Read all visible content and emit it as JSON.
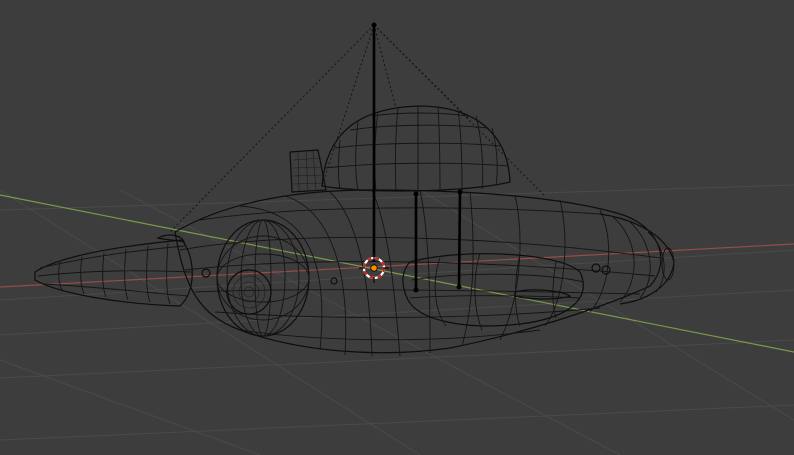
{
  "viewport": {
    "mode": "wireframe",
    "background_color": "#3d3d3d",
    "grid_color": "#4a4a4a",
    "x_axis_color": "#9a4a4a",
    "y_axis_color": "#7a9a4a",
    "wire_color": "#141414",
    "cursor_color_outer": "#ffffff",
    "cursor_color_ring": "#d02020",
    "origin_color": "#ff8a00"
  },
  "object": {
    "icon": "ufo-mesh-icon",
    "parts": [
      "dome",
      "saucer-body",
      "nose-cone",
      "left-engine",
      "right-pod",
      "tail-fin",
      "rear-cap",
      "rig-bones"
    ]
  }
}
